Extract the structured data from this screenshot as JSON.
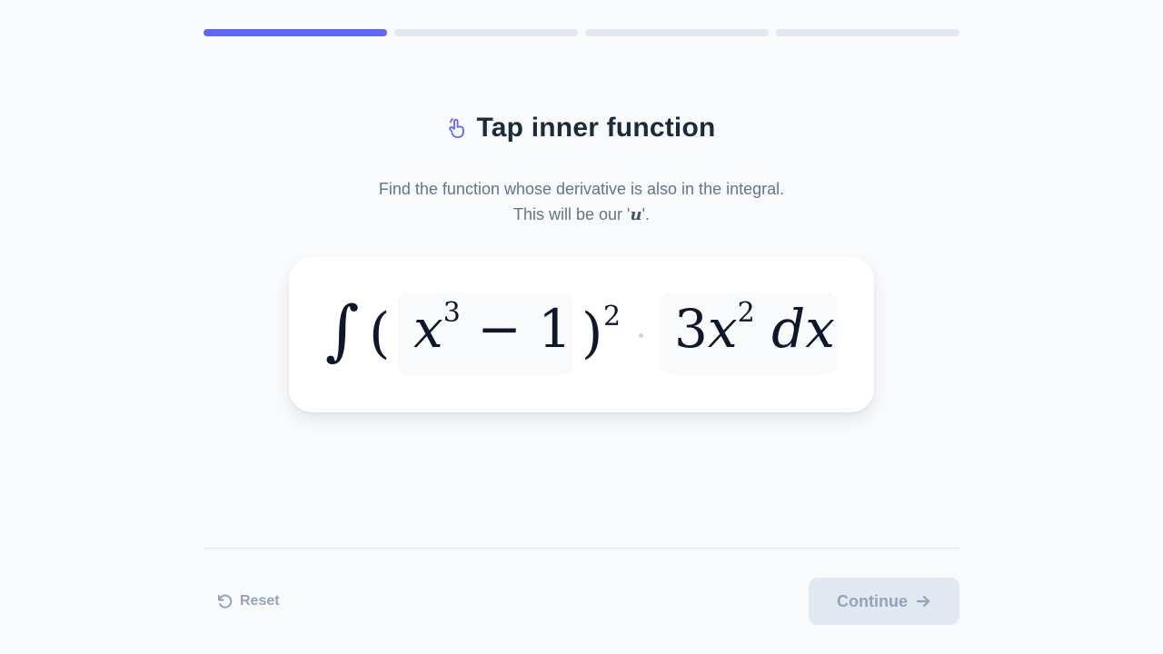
{
  "progress": {
    "total_steps": 4,
    "current_step": 1
  },
  "heading": {
    "icon": "tap-icon",
    "title": "Tap inner function"
  },
  "instructions": {
    "line1": "Find the function whose derivative is also in the integral.",
    "line2_prefix": "This will be our '",
    "line2_var": "u",
    "line2_suffix": "'."
  },
  "expression": {
    "integral_sign": "∫",
    "open_paren": "(",
    "inner_var": "x",
    "inner_exp": "3",
    "inner_rest": " − 1",
    "close_paren": ")",
    "outer_exp": "2",
    "deriv_coef": "3",
    "deriv_var": "x",
    "deriv_exp": "2",
    "deriv_dx": " dx"
  },
  "footer": {
    "reset_label": "Reset",
    "reset_icon": "undo-icon",
    "continue_label": "Continue",
    "continue_icon": "arrow-right-icon",
    "continue_enabled": false
  },
  "colors": {
    "accent": "#6366f1",
    "track": "#e2e8f0",
    "title": "#1e293b",
    "muted": "#64748b",
    "disabled_text": "#94a3b8"
  }
}
